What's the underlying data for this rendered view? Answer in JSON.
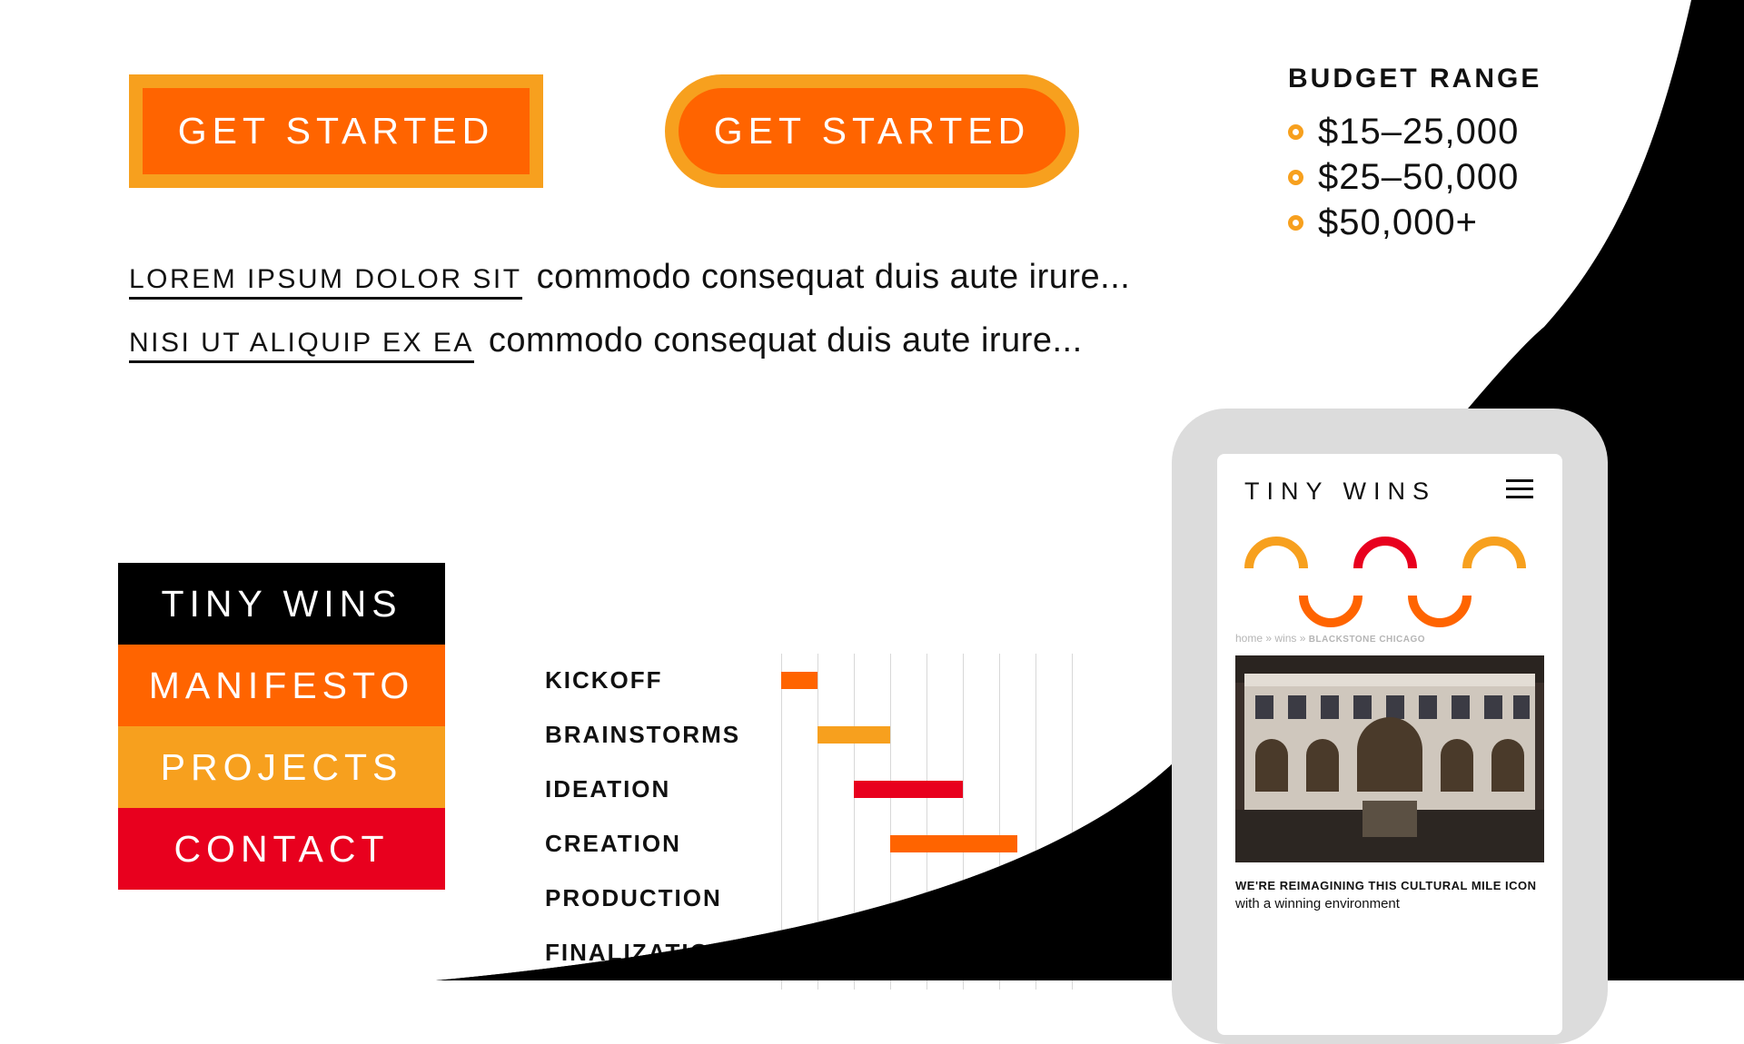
{
  "buttons": {
    "get_started_rect": "GET STARTED",
    "get_started_pill": "GET STARTED"
  },
  "budget": {
    "title": "BUDGET RANGE",
    "options": [
      "$15–25,000",
      "$25–50,000",
      "$50,000+"
    ]
  },
  "text_lines": [
    {
      "link": "LOREM IPSUM DOLOR SIT",
      "text": "commodo consequat duis aute irure..."
    },
    {
      "link": "NISI UT ALIQUIP EX EA",
      "text": "commodo consequat duis aute irure..."
    }
  ],
  "nav": {
    "items": [
      {
        "label": "TINY WINS",
        "color": "#000000"
      },
      {
        "label": "MANIFESTO",
        "color": "#ff6400"
      },
      {
        "label": "PROJECTS",
        "color": "#f7a01e"
      },
      {
        "label": "CONTACT",
        "color": "#e8001e"
      }
    ]
  },
  "timeline": {
    "phases": [
      "KICKOFF",
      "BRAINSTORMS",
      "IDEATION",
      "CREATION",
      "PRODUCTION",
      "FINALIZATION"
    ],
    "bar_colors": [
      "#ff6400",
      "#f7a01e",
      "#e8001e",
      "#ff6400"
    ]
  },
  "phone": {
    "brand": "TINY WINS",
    "breadcrumb": {
      "home": "home",
      "sep": "»",
      "wins": "wins",
      "current": "BLACKSTONE CHICAGO"
    },
    "caption_bold": "WE'RE REIMAGINING THIS CULTURAL MILE ICON",
    "caption_rest": " with a winning environment"
  },
  "colors": {
    "orange": "#ff6400",
    "amber": "#f7a01e",
    "red": "#e8001e",
    "black": "#000000"
  }
}
